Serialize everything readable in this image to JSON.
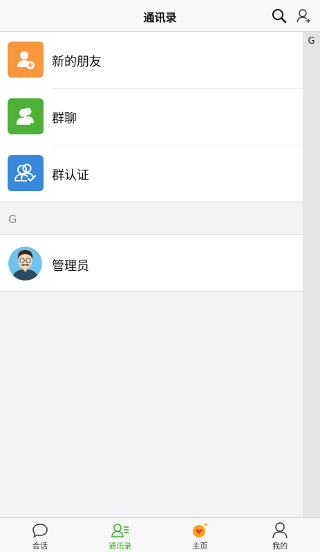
{
  "header": {
    "title": "通讯录",
    "search_icon": "search-icon",
    "add_contact_icon": "add-contact-icon"
  },
  "functions": [
    {
      "label": "新的朋友",
      "icon": "add-friend-icon",
      "color": "#f7963b"
    },
    {
      "label": "群聊",
      "icon": "group-chat-icon",
      "color": "#4cb136"
    },
    {
      "label": "群认证",
      "icon": "group-verify-icon",
      "color": "#3889db"
    }
  ],
  "sections": [
    {
      "letter": "G",
      "contacts": [
        {
          "name": "管理员",
          "avatar": "avatar-man-mustache"
        }
      ]
    }
  ],
  "index_bar": [
    "G"
  ],
  "tabbar": {
    "active_color": "#3fae2a",
    "items": [
      {
        "label": "会话",
        "icon": "chat-bubble-icon"
      },
      {
        "label": "通讯录",
        "icon": "contacts-icon",
        "active": true
      },
      {
        "label": "主页",
        "icon": "home-heart-icon"
      },
      {
        "label": "我的",
        "icon": "person-icon"
      }
    ]
  }
}
